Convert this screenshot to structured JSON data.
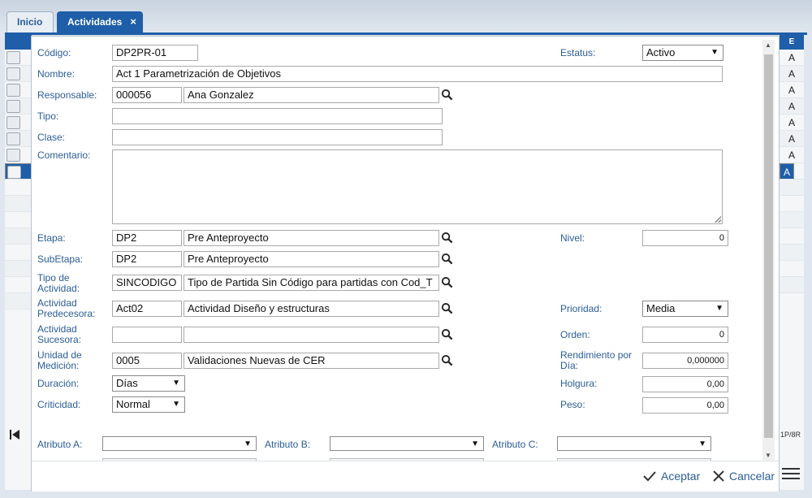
{
  "tabs": [
    {
      "label": "Inicio",
      "active": false
    },
    {
      "label": "Actividades",
      "active": true,
      "close": "×"
    }
  ],
  "left_grid": {
    "row_count": 8,
    "selected_row": 8
  },
  "right_grid": {
    "header": "E",
    "rows": [
      "A",
      "A",
      "A",
      "A",
      "A",
      "A",
      "A",
      "A"
    ],
    "page_info": "1P/8R"
  },
  "form": {
    "codigo": {
      "label": "Código:",
      "value": "DP2PR-01"
    },
    "estatus": {
      "label": "Estatus:",
      "value": "Activo"
    },
    "nombre": {
      "label": "Nombre:",
      "value": "Act 1 Parametrización de Objetivos"
    },
    "responsable": {
      "label": "Responsable:",
      "code": "000056",
      "name": "Ana Gonzalez"
    },
    "tipo": {
      "label": "Tipo:",
      "value": ""
    },
    "clase": {
      "label": "Clase:",
      "value": ""
    },
    "comentario": {
      "label": "Comentario:",
      "value": ""
    },
    "etapa": {
      "label": "Etapa:",
      "code": "DP2",
      "name": "Pre Anteproyecto"
    },
    "nivel": {
      "label": "Nivel:",
      "value": "0"
    },
    "subetapa": {
      "label": "SubEtapa:",
      "code": "DP2",
      "name": "Pre Anteproyecto"
    },
    "tipo_actividad": {
      "label_1": "Tipo de",
      "label_2": "Actividad:",
      "code": "SINCODIGO",
      "name": "Tipo de Partida Sin Código para partidas con Cod_T"
    },
    "actividad_predecesora": {
      "label_1": "Actividad",
      "label_2": "Predecesora:",
      "code": "Act02",
      "name": "Actividad Diseño y estructuras"
    },
    "prioridad": {
      "label": "Prioridad:",
      "value": "Media"
    },
    "actividad_sucesora": {
      "label_1": "Actividad",
      "label_2": "Sucesora:",
      "code": "",
      "name": ""
    },
    "orden": {
      "label": "Orden:",
      "value": "0"
    },
    "unidad_medicion": {
      "label_1": "Unidad de",
      "label_2": "Medición:",
      "code": "0005",
      "name": "Validaciones Nuevas de CER"
    },
    "rendimiento": {
      "label_1": "Rendimiento por",
      "label_2": "Día:",
      "value": "0,000000"
    },
    "duracion": {
      "label": "Duración:",
      "value": "Días"
    },
    "holgura": {
      "label": "Holgura:",
      "value": "0,00"
    },
    "criticidad": {
      "label": "Criticidad:",
      "value": "Normal"
    },
    "peso": {
      "label": "Peso:",
      "value": "0,00"
    },
    "atributo_a": {
      "label": "Atributo A:",
      "value": ""
    },
    "atributo_b": {
      "label": "Atributo B:",
      "value": ""
    },
    "atributo_c": {
      "label": "Atributo C:",
      "value": ""
    }
  },
  "footer": {
    "accept_label": "Aceptar",
    "cancel_label": "Cancelar"
  },
  "colors": {
    "accent": "#1f5ea8",
    "label": "#2b5d97"
  }
}
